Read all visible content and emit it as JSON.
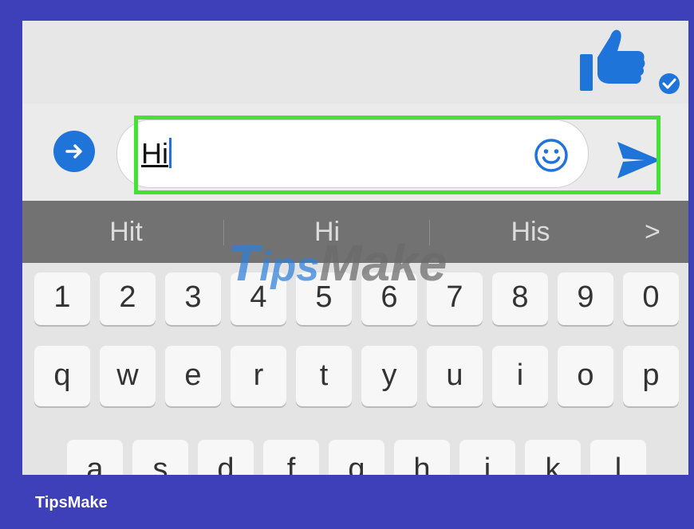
{
  "composer": {
    "input_value": "Hi",
    "emoji_icon": "smiley-icon",
    "send_icon": "send-arrow-icon",
    "more_icon": "arrow-right-circle-icon"
  },
  "chat": {
    "like_icon": "thumbs-up-icon",
    "status_icon": "seen-check-icon"
  },
  "suggestions": {
    "items": [
      "Hit",
      "Hi",
      "His"
    ],
    "more_label": ">"
  },
  "keyboard": {
    "number_row": [
      "1",
      "2",
      "3",
      "4",
      "5",
      "6",
      "7",
      "8",
      "9",
      "0"
    ],
    "letter_row_1": [
      "q",
      "w",
      "e",
      "r",
      "t",
      "y",
      "u",
      "i",
      "o",
      "p"
    ],
    "letter_row_2": [
      "a",
      "s",
      "d",
      "f",
      "g",
      "h",
      "j",
      "k",
      "l"
    ]
  },
  "watermark": {
    "part1": "T",
    "part2": "ips",
    "part3": "Make"
  },
  "footer": {
    "brand": "TipsMake"
  },
  "colors": {
    "messenger_blue": "#1f74d9",
    "highlight_green": "#45e135",
    "frame_background": "#3d40b8"
  }
}
